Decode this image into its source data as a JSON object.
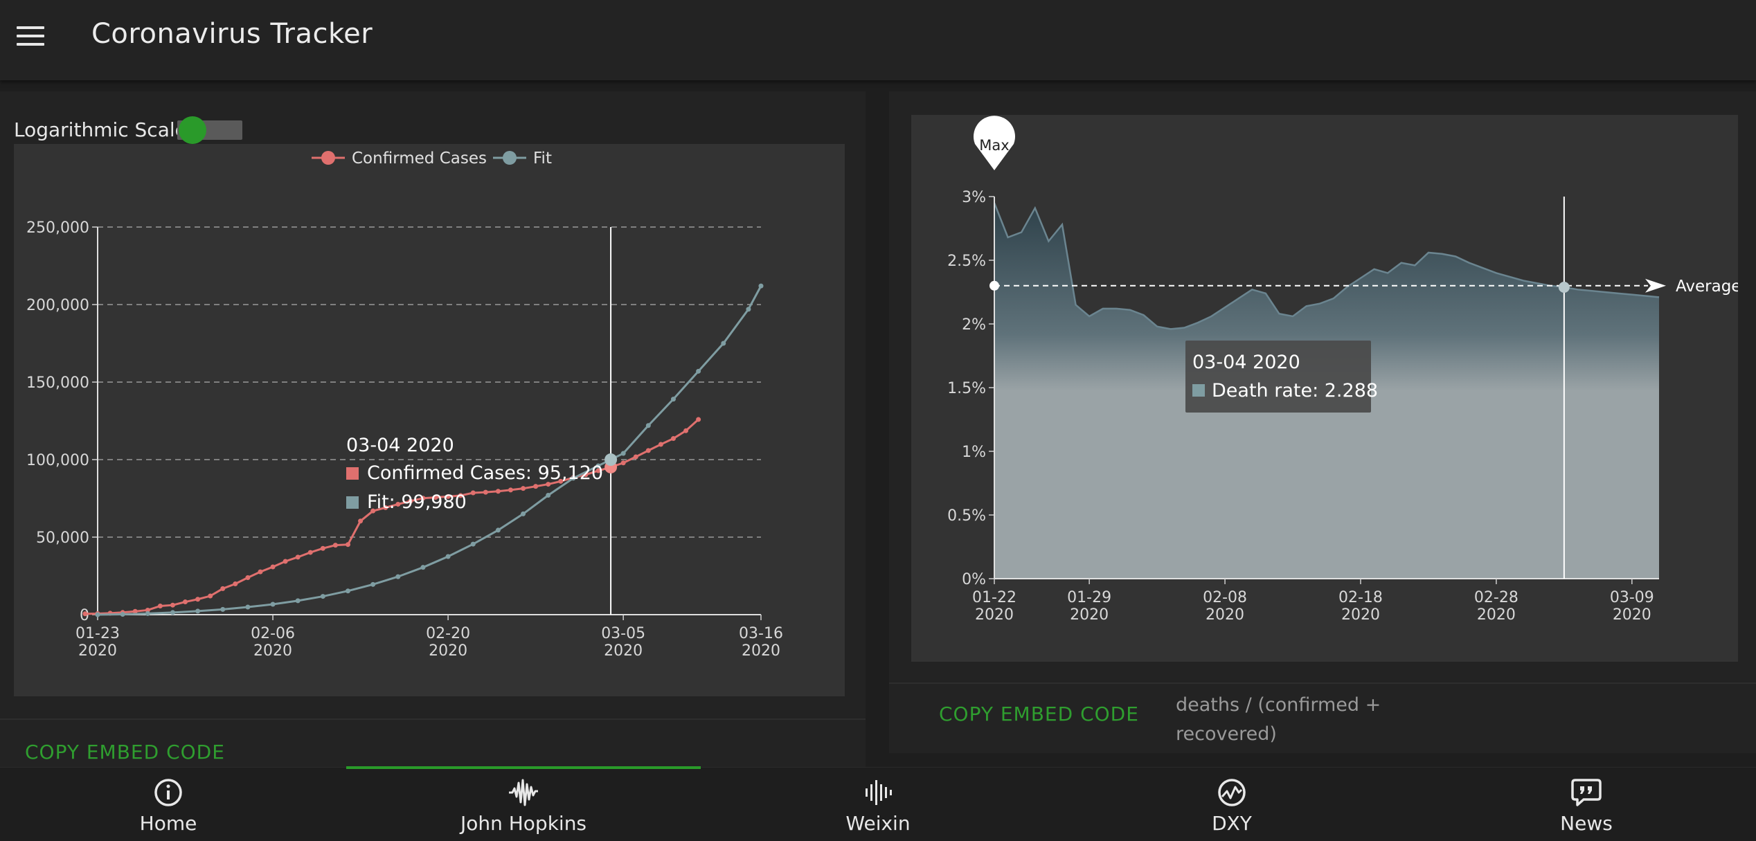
{
  "app": {
    "title": "Coronavirus Tracker"
  },
  "left_panel": {
    "toggle_label": "Logarithmic Scale",
    "toggle_on": true,
    "embed_label": "COPY EMBED CODE",
    "tooltip": {
      "date": "03-04 2020",
      "line1": "Confirmed Cases: 95,120",
      "line2": "Fit: 99,980"
    }
  },
  "right_panel": {
    "embed_label": "COPY EMBED CODE",
    "formula": "deaths / (confirmed + recovered)",
    "max_label": "Max",
    "average_label": "Average",
    "tooltip": {
      "date": "03-04 2020",
      "line1": "Death rate: 2.288"
    }
  },
  "colors": {
    "confirmed": "#e0706e",
    "fit": "#7f9da2",
    "accent": "#2a9a2a",
    "death_area": "#9aa3a6"
  },
  "chart_data": [
    {
      "type": "line",
      "title": "",
      "legend": [
        "Confirmed Cases",
        "Fit"
      ],
      "legend_position": "top-center",
      "x_start": "2020-01-23",
      "x_end": "2020-03-16",
      "xticks": [
        "01-23 2020",
        "02-06 2020",
        "02-20 2020",
        "03-05 2020",
        "03-16 2020"
      ],
      "yticks": [
        "0",
        "50,000",
        "100,000",
        "150,000",
        "200,000",
        "250,000"
      ],
      "ylim": [
        0,
        250000
      ],
      "grid": true,
      "highlight_date": "2020-03-04",
      "series": [
        {
          "name": "Confirmed Cases",
          "dates": [
            "2020-01-22",
            "2020-01-23",
            "2020-01-24",
            "2020-01-25",
            "2020-01-26",
            "2020-01-27",
            "2020-01-28",
            "2020-01-29",
            "2020-01-30",
            "2020-01-31",
            "2020-02-01",
            "2020-02-02",
            "2020-02-03",
            "2020-02-04",
            "2020-02-05",
            "2020-02-06",
            "2020-02-07",
            "2020-02-08",
            "2020-02-09",
            "2020-02-10",
            "2020-02-11",
            "2020-02-12",
            "2020-02-13",
            "2020-02-14",
            "2020-02-15",
            "2020-02-16",
            "2020-02-17",
            "2020-02-18",
            "2020-02-19",
            "2020-02-20",
            "2020-02-21",
            "2020-02-22",
            "2020-02-23",
            "2020-02-24",
            "2020-02-25",
            "2020-02-26",
            "2020-02-27",
            "2020-02-28",
            "2020-02-29",
            "2020-03-01",
            "2020-03-02",
            "2020-03-03",
            "2020-03-04",
            "2020-03-05",
            "2020-03-06",
            "2020-03-07",
            "2020-03-08",
            "2020-03-09",
            "2020-03-10",
            "2020-03-11"
          ],
          "values": [
            555,
            654,
            941,
            1434,
            2118,
            2927,
            5578,
            6166,
            8234,
            9927,
            12038,
            16787,
            19881,
            23892,
            27635,
            30817,
            34391,
            37120,
            40150,
            42762,
            44802,
            45221,
            60368,
            66885,
            69030,
            71224,
            73258,
            75136,
            75639,
            76197,
            76823,
            78579,
            78965,
            79568,
            80413,
            81395,
            82754,
            84120,
            86011,
            88369,
            90306,
            92840,
            95120,
            97886,
            101801,
            105847,
            109821,
            113590,
            118620,
            125875
          ]
        },
        {
          "name": "Fit",
          "dates": [
            "2020-01-23",
            "2020-01-25",
            "2020-01-27",
            "2020-01-29",
            "2020-01-31",
            "2020-02-02",
            "2020-02-04",
            "2020-02-06",
            "2020-02-08",
            "2020-02-10",
            "2020-02-12",
            "2020-02-14",
            "2020-02-16",
            "2020-02-18",
            "2020-02-20",
            "2020-02-22",
            "2020-02-24",
            "2020-02-26",
            "2020-02-28",
            "2020-03-01",
            "2020-03-03",
            "2020-03-04",
            "2020-03-05",
            "2020-03-07",
            "2020-03-09",
            "2020-03-11",
            "2020-03-13",
            "2020-03-15",
            "2020-03-16"
          ],
          "values": [
            0,
            200,
            700,
            1400,
            2300,
            3400,
            4900,
            6700,
            9000,
            11800,
            15300,
            19500,
            24500,
            30500,
            37500,
            45500,
            54500,
            65000,
            77000,
            88000,
            96000,
            99980,
            104000,
            122000,
            139000,
            157000,
            175000,
            197000,
            212000
          ]
        }
      ]
    },
    {
      "type": "area",
      "title": "",
      "xticks": [
        "01-22 2020",
        "01-29 2020",
        "02-08 2020",
        "02-18 2020",
        "02-28 2020",
        "03-09 2020"
      ],
      "yticks": [
        "0%",
        "0.5%",
        "1%",
        "1.5%",
        "2%",
        "2.5%",
        "3%"
      ],
      "ylim": [
        0,
        3
      ],
      "grid": false,
      "highlight_date": "2020-03-04",
      "average": 2.3,
      "series": [
        {
          "name": "Death rate",
          "dates": [
            "2020-01-22",
            "2020-01-23",
            "2020-01-24",
            "2020-01-25",
            "2020-01-26",
            "2020-01-27",
            "2020-01-28",
            "2020-01-29",
            "2020-01-30",
            "2020-01-31",
            "2020-02-01",
            "2020-02-02",
            "2020-02-03",
            "2020-02-04",
            "2020-02-05",
            "2020-02-06",
            "2020-02-07",
            "2020-02-08",
            "2020-02-09",
            "2020-02-10",
            "2020-02-11",
            "2020-02-12",
            "2020-02-13",
            "2020-02-14",
            "2020-02-15",
            "2020-02-16",
            "2020-02-17",
            "2020-02-18",
            "2020-02-19",
            "2020-02-20",
            "2020-02-21",
            "2020-02-22",
            "2020-02-23",
            "2020-02-24",
            "2020-02-25",
            "2020-02-26",
            "2020-02-27",
            "2020-02-28",
            "2020-02-29",
            "2020-03-01",
            "2020-03-02",
            "2020-03-03",
            "2020-03-04",
            "2020-03-05",
            "2020-03-06",
            "2020-03-07",
            "2020-03-08",
            "2020-03-09",
            "2020-03-10",
            "2020-03-11"
          ],
          "values": [
            2.95,
            2.68,
            2.72,
            2.91,
            2.65,
            2.78,
            2.15,
            2.06,
            2.12,
            2.12,
            2.11,
            2.07,
            1.98,
            1.96,
            1.97,
            2.01,
            2.06,
            2.13,
            2.2,
            2.27,
            2.24,
            2.08,
            2.06,
            2.14,
            2.16,
            2.2,
            2.29,
            2.36,
            2.43,
            2.4,
            2.48,
            2.46,
            2.56,
            2.55,
            2.53,
            2.48,
            2.44,
            2.4,
            2.37,
            2.34,
            2.32,
            2.3,
            2.288,
            2.27,
            2.26,
            2.25,
            2.24,
            2.23,
            2.22,
            2.21
          ]
        }
      ]
    }
  ],
  "nav": [
    {
      "label": "Home",
      "icon": "info-icon"
    },
    {
      "label": "John Hopkins",
      "icon": "waveform-icon"
    },
    {
      "label": "Weixin",
      "icon": "signal-bars-icon"
    },
    {
      "label": "DXY",
      "icon": "pulse-icon"
    },
    {
      "label": "News",
      "icon": "quote-bubble-icon"
    }
  ]
}
